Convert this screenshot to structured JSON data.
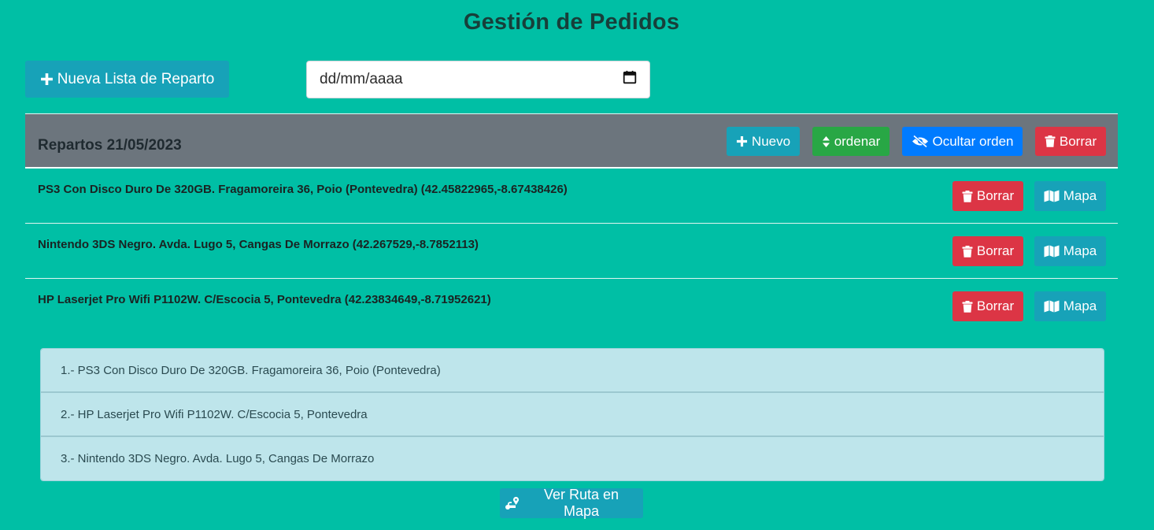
{
  "header": {
    "title": "Gestión de Pedidos"
  },
  "toolbar": {
    "new_list_label": "Nueva Lista de Reparto",
    "date_placeholder": "dd/mm/aaaa"
  },
  "card": {
    "title": "Repartos 21/05/2023",
    "buttons": {
      "nuevo": "Nuevo",
      "ordenar": "ordenar",
      "ocultar": "Ocultar orden",
      "borrar": "Borrar"
    },
    "rows": [
      {
        "text": "PS3 Con Disco Duro De 320GB. Fragamoreira 36, Poio (Pontevedra) (42.45822965,-8.67438426)",
        "delete_label": "Borrar",
        "map_label": "Mapa"
      },
      {
        "text": "Nintendo 3DS Negro. Avda. Lugo 5, Cangas De Morrazo (42.267529,-8.7852113)",
        "delete_label": "Borrar",
        "map_label": "Mapa"
      },
      {
        "text": "HP Laserjet Pro Wifi P1102W. C/Escocia 5, Pontevedra (42.23834649,-8.71952621)",
        "delete_label": "Borrar",
        "map_label": "Mapa"
      }
    ]
  },
  "order_list": [
    "1.- PS3 Con Disco Duro De 320GB. Fragamoreira 36, Poio (Pontevedra)",
    "2.- HP Laserjet Pro Wifi P1102W. C/Escocia 5, Pontevedra",
    "3.- Nintendo 3DS Negro. Avda. Lugo 5, Cangas De Morrazo"
  ],
  "route_button_label": "Ver Ruta en Mapa",
  "icons": {
    "plus": "plus-icon",
    "calendar": "calendar-icon",
    "sort": "sort-icon",
    "eye_slash": "eye-slash-icon",
    "trash": "trash-icon",
    "map": "map-icon",
    "route": "route-icon"
  },
  "colors": {
    "background": "#00bfa5",
    "info": "#17a2b8",
    "success": "#28a745",
    "primary": "#007bff",
    "danger": "#dc3545",
    "secondary": "#6c757d",
    "list_bg": "#bee5eb"
  }
}
